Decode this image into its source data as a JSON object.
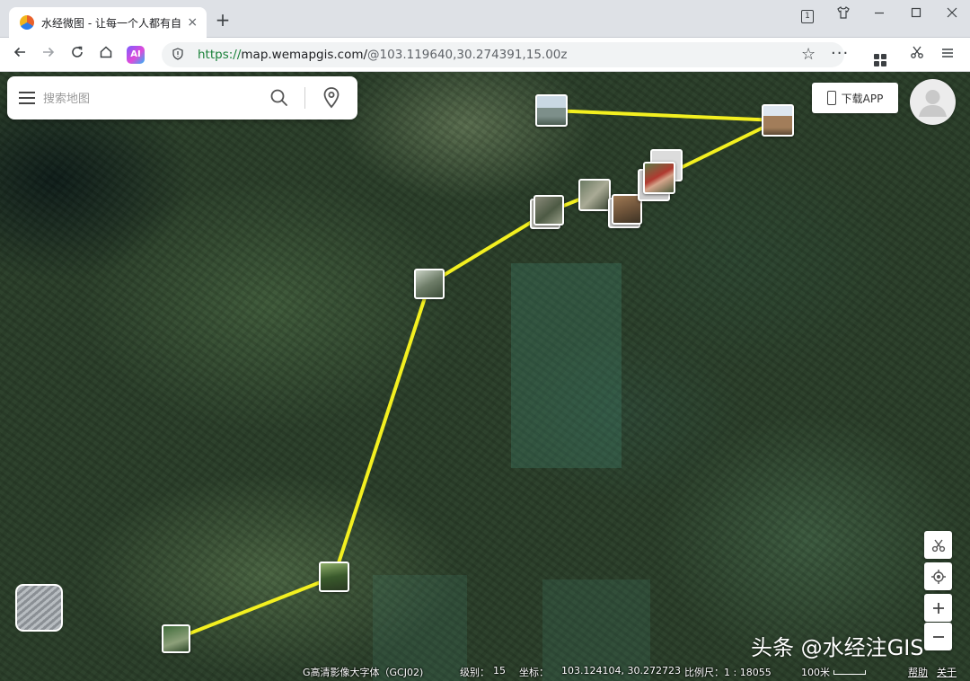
{
  "browser": {
    "tab_title": "水经微图 - 让每一个人都有自",
    "tab_close": "×",
    "new_tab": "+",
    "window_badge": "1",
    "url_scheme": "https://",
    "url_host": "map.wemapgis.com/",
    "url_path": "@103.119640,30.274391,15.00z",
    "ai_label": "AI"
  },
  "search": {
    "placeholder": "搜索地图"
  },
  "header": {
    "download_label": "下载APP"
  },
  "status": {
    "layer": "G高清影像大字体（GCJ02)",
    "zoom_label": "级别：",
    "zoom_value": "15",
    "coord_label": "坐标：",
    "coord_value": "103.124104, 30.272723",
    "scale_label": "比例尺：1 : 18055",
    "scale_bar": "100米",
    "help": "帮助",
    "about": "关于"
  },
  "watermark": "头条 @水经注GIS",
  "colors": {
    "route": "#f3f020",
    "url_scheme": "#188038"
  },
  "icons": [
    "menu-icon",
    "search-icon",
    "pin-icon",
    "phone-icon",
    "avatar-icon",
    "layer-switch",
    "scissors-icon",
    "locate-icon",
    "zoom-in-icon",
    "zoom-out-icon",
    "star-icon",
    "more-icon",
    "extensions-icon"
  ]
}
